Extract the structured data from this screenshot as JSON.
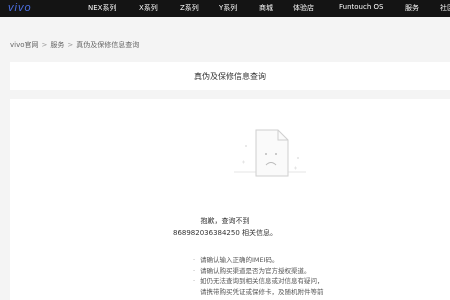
{
  "header": {
    "logo": "vivo",
    "nav": [
      "NEX系列",
      "X系列",
      "Z系列",
      "Y系列",
      "商城",
      "体验店",
      "Funtouch OS",
      "服务",
      "社区"
    ]
  },
  "breadcrumb": {
    "items": [
      "vivo官网",
      "服务",
      "真伪及保修信息查询"
    ],
    "separator": ">"
  },
  "page": {
    "title": "真伪及保修信息查询"
  },
  "result": {
    "message_line1": "抱歉，查询不到",
    "message_line2": "868982036384250 相关信息。",
    "tips": [
      "请确认输入正确的IMEI码。",
      "请确认购买渠道是否为官方授权渠道。",
      "如仍无法查询到相关信息或对信息有疑问，",
      "请携带购买凭证或保修卡，及随机附件等前"
    ],
    "tip_bullet": "·"
  },
  "colors": {
    "topbar": "#141414",
    "logo": "#4c6fe0",
    "background": "#f4f4f4",
    "panel": "#ffffff"
  }
}
